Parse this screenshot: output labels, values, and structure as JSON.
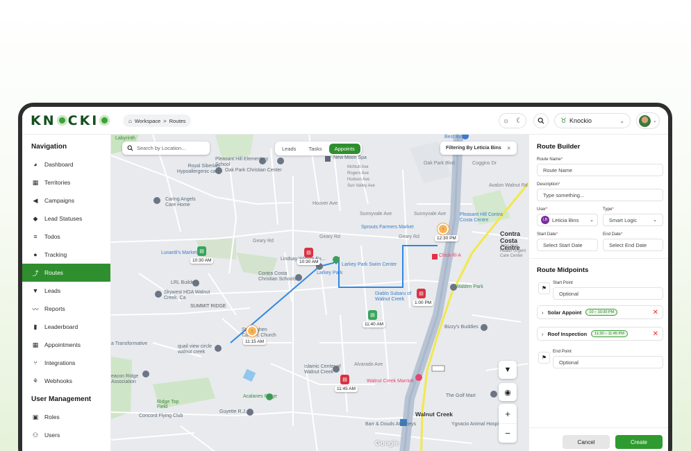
{
  "app": {
    "logo_text": "KN",
    "logo_text2": "CKI"
  },
  "breadcrumb": {
    "root": "Workspace",
    "separator": ">",
    "current": "Routes"
  },
  "topbar": {
    "workspace": "Knockio",
    "sun_icon": "sun-icon",
    "moon_icon": "moon-icon"
  },
  "sidebar": {
    "heading": "Navigation",
    "items": [
      {
        "label": "Dashboard",
        "icon": "pie-chart-icon",
        "glyph": "◕"
      },
      {
        "label": "Territories",
        "icon": "map-icon",
        "glyph": "▦"
      },
      {
        "label": "Campaigns",
        "icon": "megaphone-icon",
        "glyph": "◀"
      },
      {
        "label": "Lead Statuses",
        "icon": "tag-icon",
        "glyph": "◆"
      },
      {
        "label": "Todos",
        "icon": "list-icon",
        "glyph": "≡"
      },
      {
        "label": "Tracking",
        "icon": "location-pin-icon",
        "glyph": "●"
      },
      {
        "label": "Routes",
        "icon": "route-icon",
        "glyph": "⤴"
      },
      {
        "label": "Leads",
        "icon": "funnel-icon",
        "glyph": "▼"
      },
      {
        "label": "Reports",
        "icon": "pulse-icon",
        "glyph": "〰"
      },
      {
        "label": "Leaderboard",
        "icon": "bar-chart-icon",
        "glyph": "▮"
      },
      {
        "label": "Appointments",
        "icon": "calendar-icon",
        "glyph": "▦"
      },
      {
        "label": "Integrations",
        "icon": "branch-icon",
        "glyph": "⑂"
      },
      {
        "label": "Webhooks",
        "icon": "webhook-icon",
        "glyph": "⚘"
      }
    ],
    "active_index": 6,
    "heading2": "User Management",
    "items2": [
      {
        "label": "Roles",
        "icon": "id-card-icon",
        "glyph": "▣"
      },
      {
        "label": "Users",
        "icon": "users-icon",
        "glyph": "⚇"
      }
    ]
  },
  "map": {
    "search_placeholder": "Search by Location...",
    "tabs": [
      "Leads",
      "Tasks",
      "Appoints"
    ],
    "active_tab": "Appoints",
    "filter_prefix": "Filtering By",
    "filter_user": "Leticia Bins",
    "labels": {
      "labyrinth": "Labyrinth",
      "pleasant_hill": "Pleasant Hill Elementary School",
      "royal_siberian": "Royal Siberian Hypoallergenic cats",
      "oak_park_christian": "Oak Park Christian Center",
      "new_moon_spa": "New Moon Spa",
      "mcnutt": "McNutt Ave",
      "rogers": "Rogers Ave",
      "hudson": "Hudson Ave",
      "sun_valley": "Sun Valley Ave",
      "oak_park_blvd": "Oak Park Blvd",
      "coggins": "Coggins Dr",
      "avalon": "Avalon Walnut Rd",
      "best_buy": "Best Buy",
      "caring_angels": "Caring Angels Care Home",
      "hoover": "Hoover Ave",
      "sunnyvale": "Sunnyvale Ave",
      "pleasant_hill_cc": "Pleasant Hill Contra Costa Centre",
      "sprouts": "Sprouts Farmers Market",
      "geary": "Geary Rd",
      "contra_costa_centre": "Contra Costa Centre",
      "john_muir": "John Muir Health Urgent Care Center",
      "lunardis": "Lunardi's Market",
      "lindsay": "Lindsay Wildlife Ex...",
      "larkey": "Larkey Park Swim Center",
      "larkey_park": "Larkey Park",
      "contra_costa_christian": "Contra Costa Christian Schools",
      "chick_fil_a": "Chick-fil-A",
      "lrl": "LRL Builders",
      "skywest": "Skywest HOA Walnut Creek, Ca",
      "summit_ridge": "SUMMIT RIDGE",
      "diablo": "Diablo Subaru of Walnut Creek",
      "walden_park": "Walden Park",
      "bizzys": "Bizzy's Buddies",
      "st_stephen": "St. Stephen Catholic Church",
      "transformative": "a Transformative",
      "quail": "quail view circle walnut creek",
      "islamic": "Islamic Center of Walnut Creek",
      "alvarado": "Alvarado Ave",
      "walnut_creek_marriott": "Walnut Creek Marriott",
      "golf_mart": "The Golf Mart",
      "beacon": "eacon Ridge Association",
      "acalanes": "Acalanes Ridge",
      "ridge_top": "Ridge Top Field",
      "concord_flying": "Concord Flying Club",
      "guyette": "Guyette R.J.",
      "walnut_creek": "Walnut Creek",
      "barr": "Barr & Douds Attorneys",
      "ygnacio": "Ygnacio Animal Hospital",
      "google": "Google"
    },
    "times": [
      "10:30 AM",
      "10:30 AM",
      "12:30 PM",
      "1:00 PM",
      "11:40 AM",
      "11:15 AM",
      "11:45 AM"
    ]
  },
  "panel": {
    "title": "Route Builder",
    "route_name_label": "Route Name",
    "route_name_placeholder": "Route Name",
    "description_label": "Description",
    "description_placeholder": "Type something...",
    "user_label": "User",
    "user_initials": "LB",
    "user_value": "Leticia Bins",
    "type_label": "Type",
    "type_value": "Smart Logic",
    "start_date_label": "Start Date",
    "start_date_placeholder": "Select Start Date",
    "end_date_label": "End Date",
    "end_date_placeholder": "Select End Date",
    "midpoints_title": "Route Midpoints",
    "start_point_label": "Start Point",
    "start_point_placeholder": "Optional",
    "midpoints": [
      {
        "name": "Solar Appoint",
        "time": "10 – 10:30 PM"
      },
      {
        "name": "Roof Inspection",
        "time": "11:30 – 11:45 PM"
      }
    ],
    "end_point_label": "End Point",
    "end_point_placeholder": "Optional",
    "cancel_label": "Cancel",
    "create_label": "Create"
  },
  "colors": {
    "accent": "#2f8f2f",
    "route": "#2f86e6",
    "pin_red": "#d83344",
    "pin_green": "#38a55b",
    "highway": "#f2e84a"
  }
}
